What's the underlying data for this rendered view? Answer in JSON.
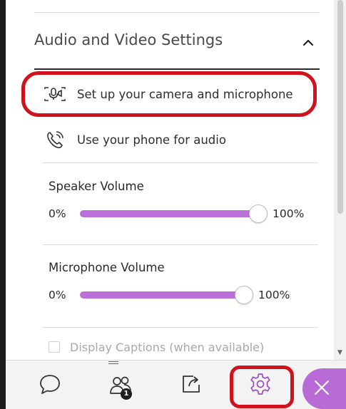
{
  "panel": {
    "section_title": "Audio and Video Settings",
    "collapse_icon": "chevron-up-icon"
  },
  "menu": {
    "camera": {
      "label": "Set up your camera and microphone",
      "icon": "camera-microphone-icon"
    },
    "phone": {
      "label": "Use your phone for audio",
      "icon": "phone-icon"
    }
  },
  "speaker_volume": {
    "label": "Speaker Volume",
    "min_label": "0%",
    "max_label": "100%",
    "value": 100
  },
  "microphone_volume": {
    "label": "Microphone Volume",
    "min_label": "0%",
    "max_label": "100%",
    "value": 100
  },
  "captions": {
    "label": "Display Captions (when available)",
    "checked": false
  },
  "bottom_bar": {
    "chat_icon": "chat-icon",
    "participants_icon": "participants-icon",
    "participants_count": "1",
    "share_icon": "share-content-icon",
    "settings_icon": "settings-gear-icon",
    "close_icon": "close-icon"
  },
  "colors": {
    "accent": "#bb6fd9",
    "highlight": "#d0121d",
    "close_button": "#b86ad6"
  }
}
